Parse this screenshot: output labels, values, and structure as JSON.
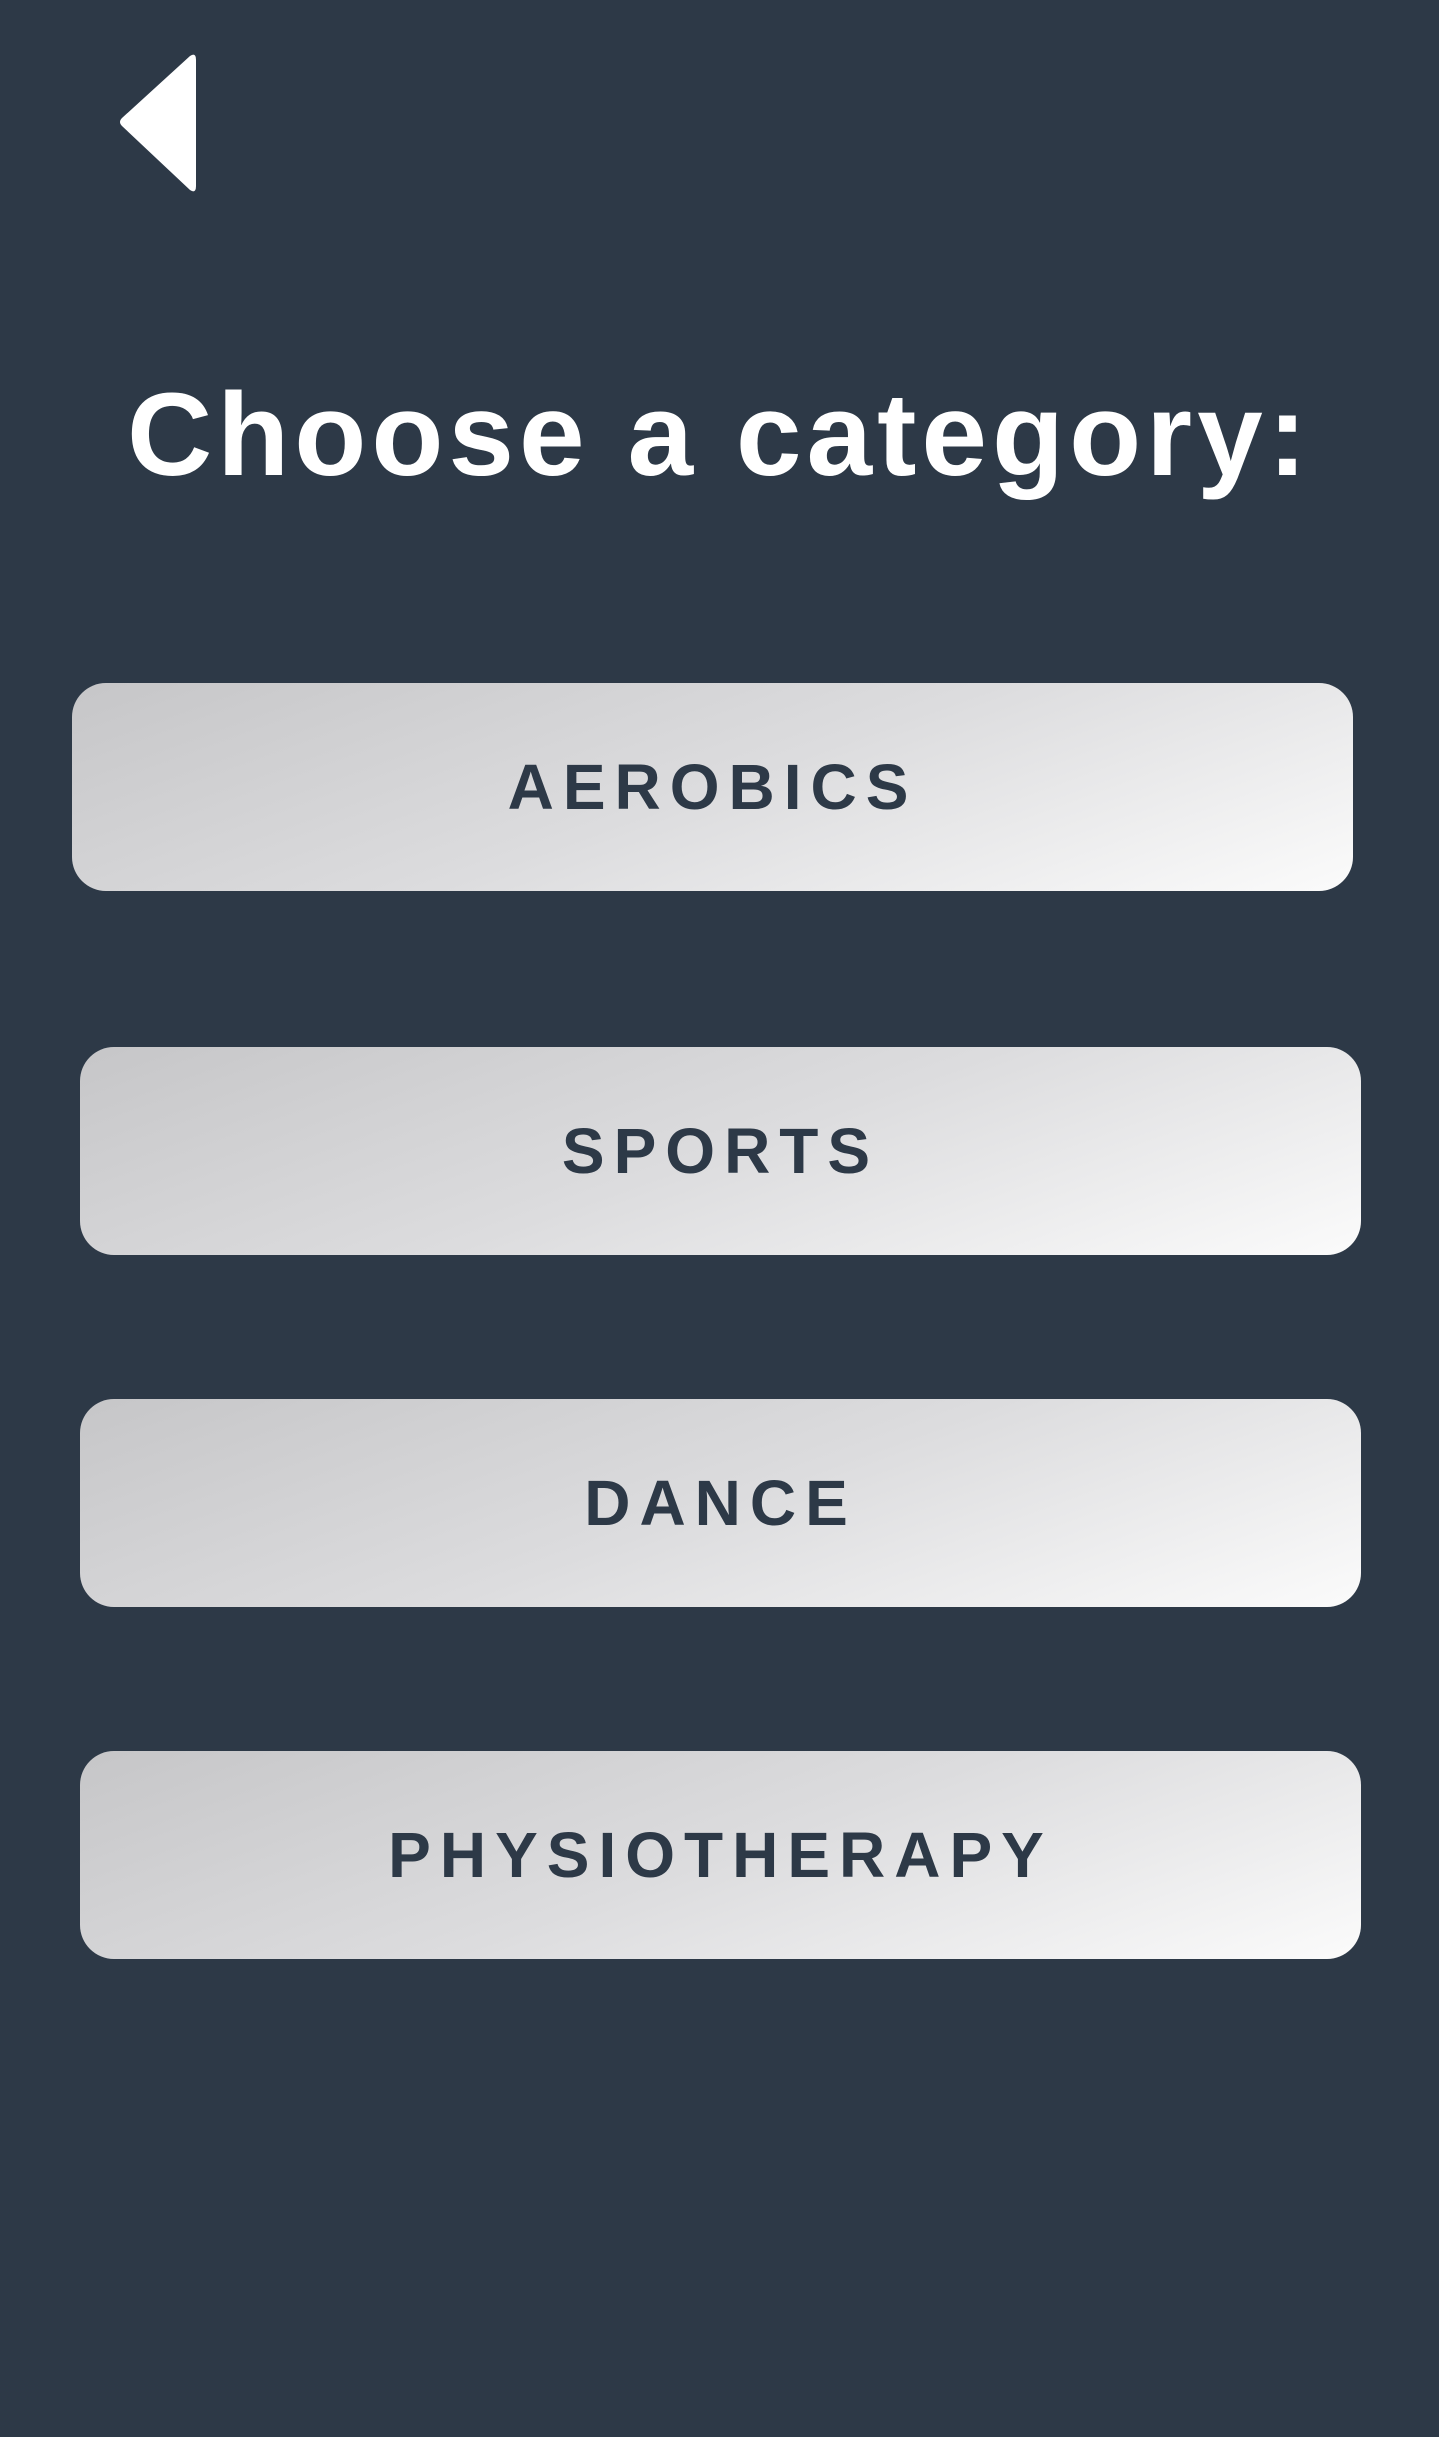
{
  "header": {
    "back_icon": "back-triangle-icon",
    "title": "Choose a category:"
  },
  "categories": [
    {
      "label": "AEROBICS"
    },
    {
      "label": "SPORTS"
    },
    {
      "label": "DANCE"
    },
    {
      "label": "PHYSIOTHERAPY"
    }
  ],
  "colors": {
    "background": "#2d3947",
    "title_text": "#ffffff",
    "button_text": "#2d3947",
    "button_gradient_start": "#c6c6c8",
    "button_gradient_end": "#fbfbfb",
    "back_icon": "#ffffff"
  }
}
